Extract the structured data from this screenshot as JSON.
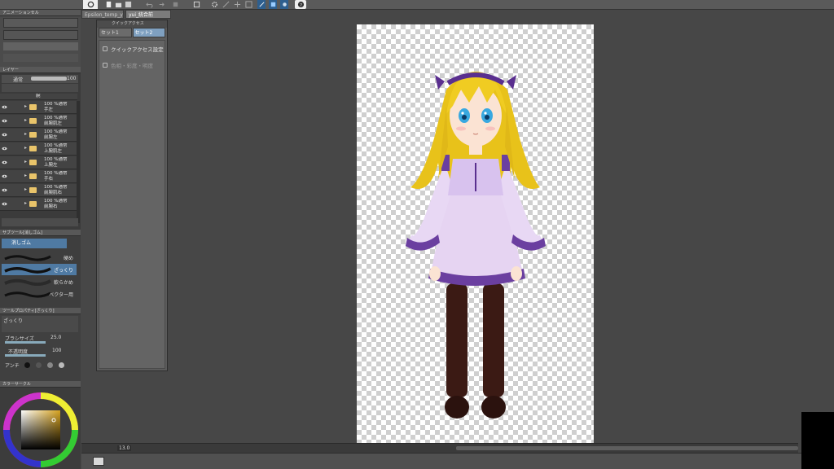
{
  "document_tabs": [
    "Epsilon_temp_ya",
    "yui_統合前"
  ],
  "panels": {
    "animation": "アニメーションセル",
    "layer": "レイヤー",
    "sub_tool": "サブツール[消しゴム]",
    "tool_property": "ツールプロパティ[ざっくり]",
    "color_circle": "カラーサークル"
  },
  "layer_panel": {
    "blend_mode": "通常",
    "opacity": "100",
    "layers": [
      {
        "line1": "腕",
        "line2": ""
      },
      {
        "line1": "100 %通常",
        "line2": "手左"
      },
      {
        "line1": "100 %通常",
        "line2": "前腕肌左"
      },
      {
        "line1": "100 %通常",
        "line2": "前腕左"
      },
      {
        "line1": "100 %通常",
        "line2": "上腕肌左"
      },
      {
        "line1": "100 %通常",
        "line2": "上腕左"
      },
      {
        "line1": "100 %通常",
        "line2": "手右"
      },
      {
        "line1": "100 %通常",
        "line2": "前腕肌右"
      },
      {
        "line1": "100 %通常",
        "line2": "前腕右"
      }
    ]
  },
  "sub_tool": {
    "group": "消しゴム",
    "items": [
      "硬め",
      "ざっくり",
      "軟らかめ",
      "ベクター用"
    ]
  },
  "tool_property": {
    "name": "ざっくり",
    "brush_size_label": "ブラシサイズ",
    "brush_size": "25.0",
    "opacity_label": "不透明度",
    "opacity": "100",
    "antialias_label": "アンチ"
  },
  "quick_access": {
    "title": "クイックアクセス",
    "tabs": [
      "セット1",
      "セット2"
    ],
    "items": [
      "クイックアクセス設定",
      "色相・彩度・明度"
    ]
  },
  "status": {
    "zoom": "13.0"
  },
  "colors": {
    "accent": "#7fa0c0",
    "panel": "#3f3f3f",
    "workspace": "#474747"
  }
}
